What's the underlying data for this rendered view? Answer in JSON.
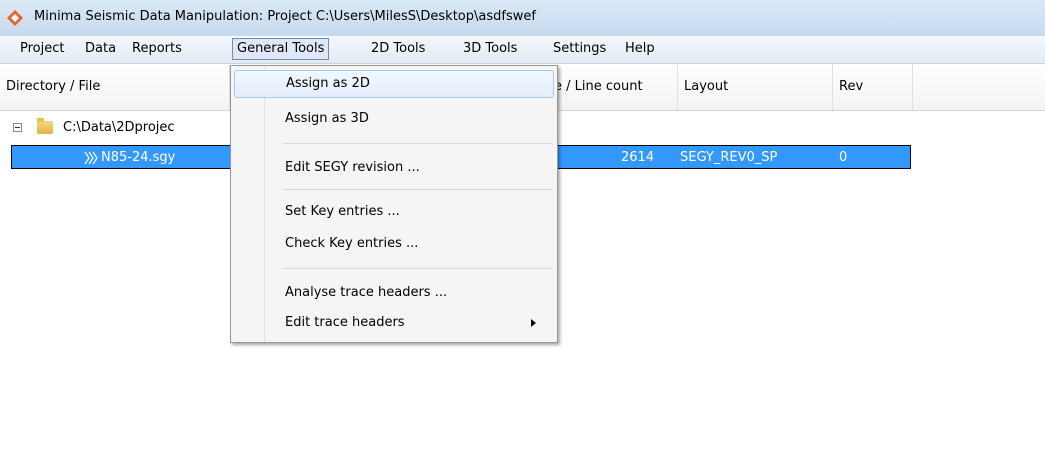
{
  "window": {
    "title": "Minima Seismic Data Manipulation: Project C:\\Users\\MilesS\\Desktop\\asdfswef",
    "icon": "app-logo-icon"
  },
  "menubar": {
    "items": [
      {
        "label": "Project"
      },
      {
        "label": "Data"
      },
      {
        "label": "Reports"
      },
      {
        "label": "General Tools"
      },
      {
        "label": "2D Tools"
      },
      {
        "label": "3D Tools"
      },
      {
        "label": "Settings"
      },
      {
        "label": "Help"
      }
    ],
    "active": "General Tools"
  },
  "columns": {
    "directory": "Directory / File",
    "linecount": "e / Line count",
    "layout": "Layout",
    "rev": "Rev"
  },
  "tree": {
    "folder": {
      "name": "C:\\Data\\2Dprojec"
    },
    "file": {
      "name": "N85-24.sgy",
      "count": "2614",
      "layout": "SEGY_REV0_SP",
      "rev": "0"
    }
  },
  "dropdown": {
    "items": {
      "assign2d": "Assign as 2D",
      "assign3d": "Assign as 3D",
      "editsegy": "Edit SEGY revision ...",
      "setkey": "Set Key entries ...",
      "checkkey": "Check Key entries ...",
      "analyse": "Analyse trace headers ...",
      "edittrace": "Edit trace headers"
    },
    "hovered": "Assign as 2D"
  },
  "colors": {
    "selection": "#3399ff",
    "logo": "#e8632b"
  }
}
